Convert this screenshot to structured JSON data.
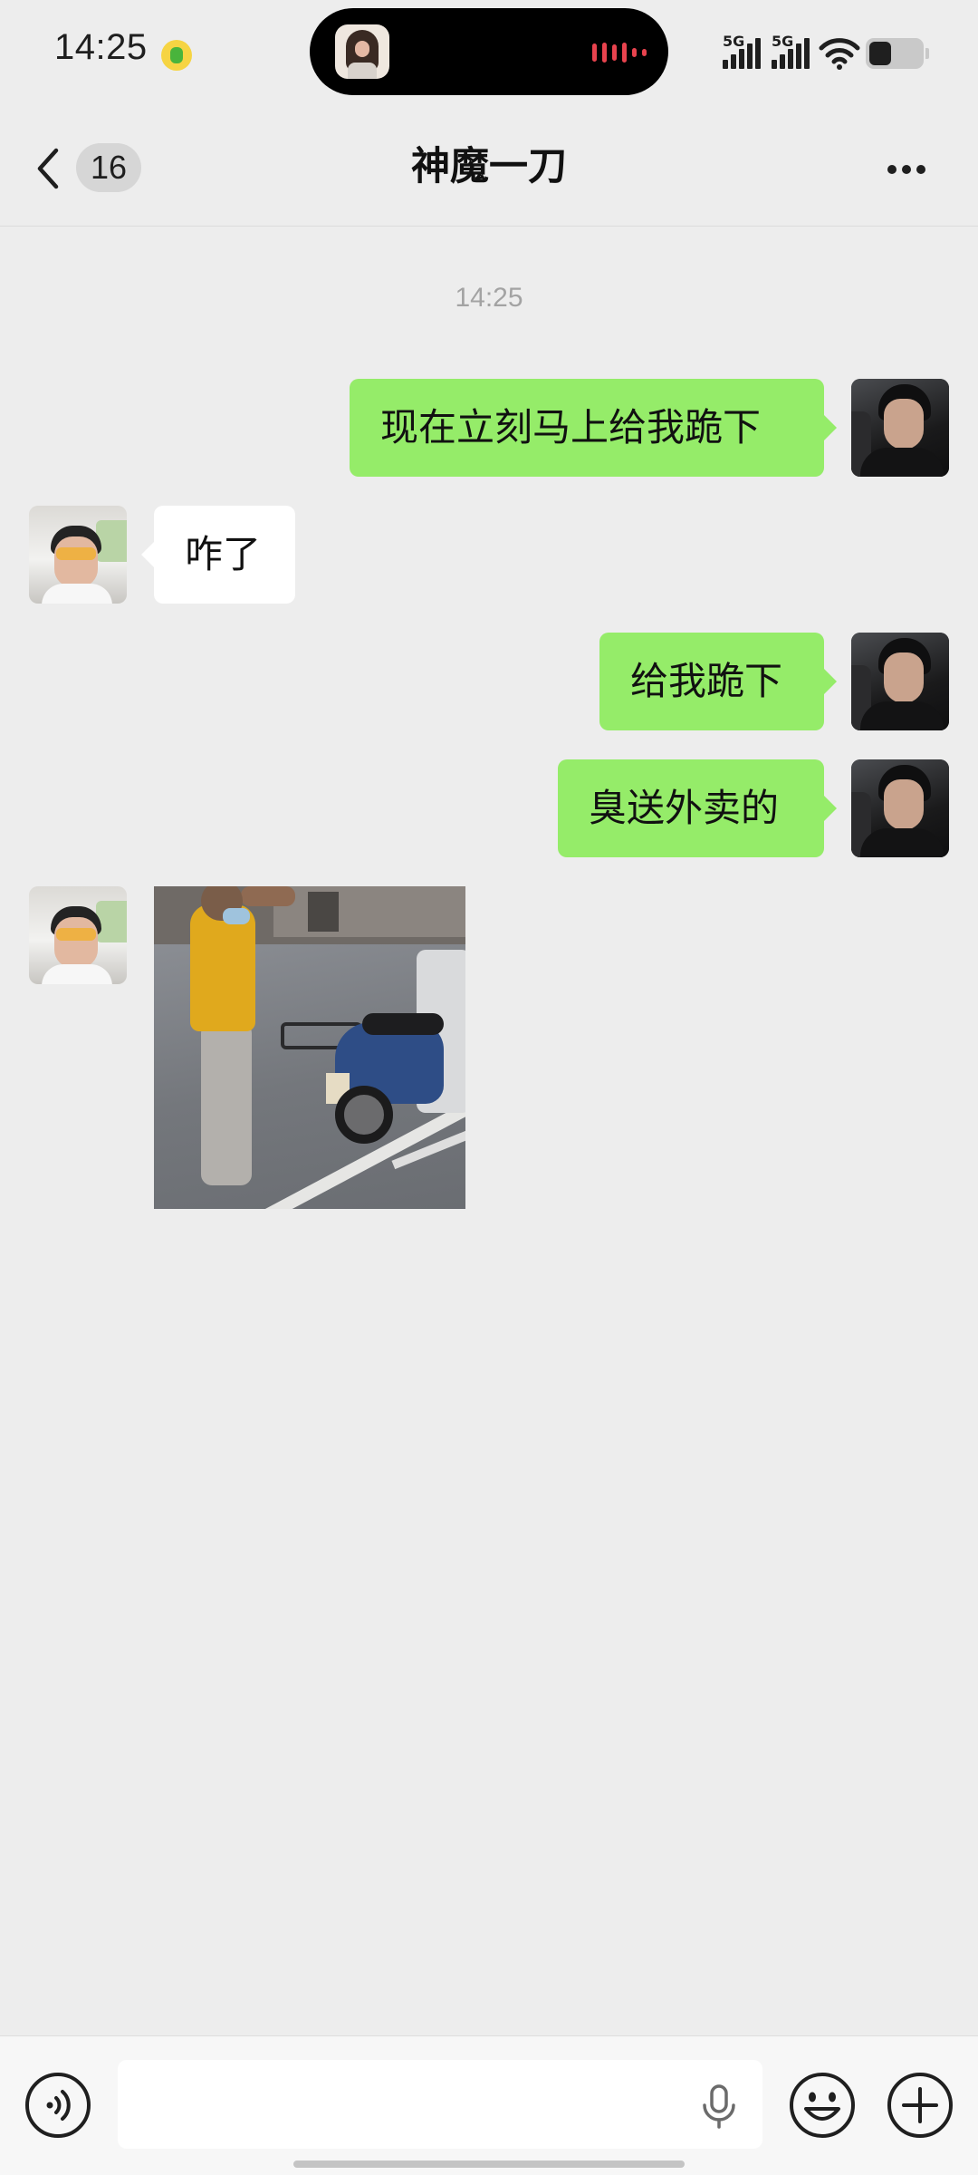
{
  "status_bar": {
    "time": "14:25",
    "network_1": "5G",
    "network_2": "5G"
  },
  "nav": {
    "back_badge": "16",
    "title": "神魔一刀"
  },
  "chat": {
    "timestamp": "14:25",
    "messages": [
      {
        "sender": "me",
        "type": "text",
        "text": "现在立刻马上给我跪下"
      },
      {
        "sender": "other",
        "type": "text",
        "text": "咋了"
      },
      {
        "sender": "me",
        "type": "text",
        "text": "给我跪下"
      },
      {
        "sender": "me",
        "type": "text",
        "text": "臭送外卖的"
      },
      {
        "sender": "other",
        "type": "image"
      }
    ]
  },
  "input_bar": {
    "value": "",
    "placeholder": ""
  },
  "icons": {
    "back": "chevron-left-icon",
    "more": "more-dots-icon",
    "voice": "voice-mode-icon",
    "mic": "microphone-icon",
    "emoji": "emoji-icon",
    "plus": "plus-icon"
  },
  "colors": {
    "background": "#ededed",
    "my_bubble": "#95ec69",
    "their_bubble": "#ffffff",
    "timestamp": "#a3a3a3",
    "recording_wave": "#e8434e"
  }
}
